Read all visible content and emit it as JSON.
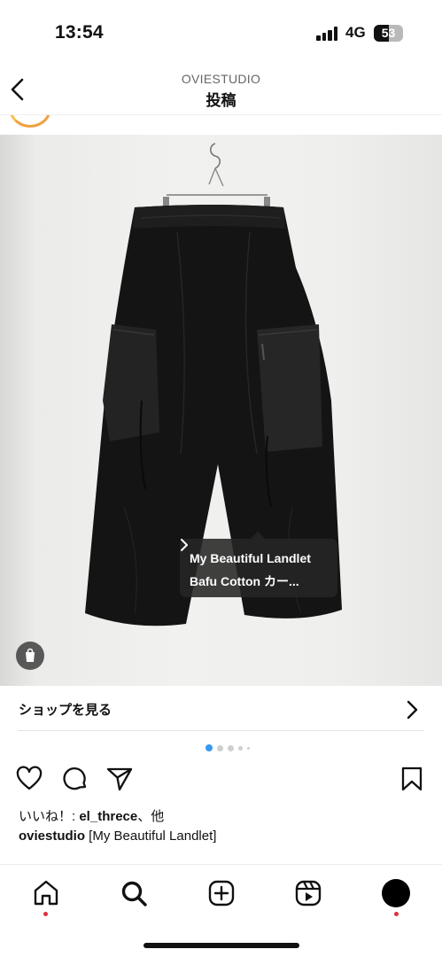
{
  "status_bar": {
    "time": "13:54",
    "network": "4G",
    "battery": "53",
    "battery_level": 0.53
  },
  "header": {
    "account": "OVIESTUDIO",
    "title": "投稿"
  },
  "product_tag": {
    "line1": "My Beautiful Landlet",
    "line2": "Bafu Cotton カー..."
  },
  "shop": {
    "label": "ショップを見る"
  },
  "carousel": {
    "count": 5,
    "active_index": 0
  },
  "likes": {
    "prefix": "いいね！: ",
    "user": "el_threce",
    "suffix": "、他"
  },
  "caption": {
    "user": "oviestudio",
    "text": " [My Beautiful Landlet]"
  },
  "colors": {
    "accent_blue": "#3897f0",
    "notification_red": "#e0303c",
    "tag_bg": "#262626"
  },
  "icons": {
    "header": [
      "back-chevron-icon"
    ],
    "actions": [
      "heart-icon",
      "comment-icon",
      "share-icon",
      "bookmark-icon"
    ],
    "tabs": [
      "home-icon",
      "search-icon",
      "create-icon",
      "reels-icon",
      "profile-avatar"
    ]
  }
}
